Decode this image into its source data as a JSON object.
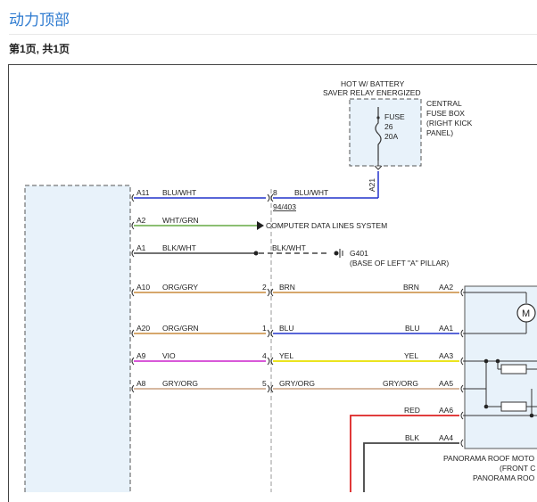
{
  "header": {
    "title": "动力顶部",
    "page_info": "第1页, 共1页"
  },
  "diagram": {
    "hot_label_1": "HOT W/ BATTERY",
    "hot_label_2": "SAVER RELAY ENERGIZED",
    "fuse_box_1": "CENTRAL",
    "fuse_box_2": "FUSE BOX",
    "fuse_box_3": "(RIGHT KICK",
    "fuse_box_4": "PANEL)",
    "fuse_1": "FUSE",
    "fuse_2": "26",
    "fuse_3": "20A",
    "fuse_pin": "A21",
    "wires": {
      "a11_pin": "A11",
      "a11_color": "BLU/WHT",
      "c8_pin": "8",
      "c8_color": "BLU/WHT",
      "c8_ref": "94/403",
      "a2_pin": "A2",
      "a2_color": "WHT/GRN",
      "a2_dest": "COMPUTER DATA LINES SYSTEM",
      "a1_pin": "A1",
      "a1_color": "BLK/WHT",
      "a1_color2": "BLK/WHT",
      "ground": "G401",
      "ground_loc": "(BASE OF LEFT \"A\" PILLAR)",
      "a10_pin": "A10",
      "a10_color": "ORG/GRY",
      "a10_mid_pin": "2",
      "a10_mid_color": "BRN",
      "a10_end_color": "BRN",
      "a10_end_pin": "AA2",
      "a20_pin": "A20",
      "a20_color": "ORG/GRN",
      "a20_mid_pin": "1",
      "a20_mid_color": "BLU",
      "a20_end_color": "BLU",
      "a20_end_pin": "AA1",
      "a9_pin": "A9",
      "a9_color": "VIO",
      "a9_mid_pin": "4",
      "a9_mid_color": "YEL",
      "a9_end_color": "YEL",
      "a9_end_pin": "AA3",
      "a8_pin": "A8",
      "a8_color": "GRY/ORG",
      "a8_mid_pin": "5",
      "a8_mid_color": "GRY/ORG",
      "a8_end_color": "GRY/ORG",
      "a8_end_pin": "AA5",
      "red_color": "RED",
      "red_pin": "AA6",
      "blk_color": "BLK",
      "blk_pin": "AA4"
    },
    "motor_label": "M",
    "motor_1": "PANORAMA ROOF MOTO",
    "motor_2": "(FRONT C",
    "motor_3": "PANORAMA ROO",
    "colors": {
      "blue": "#2233cc",
      "green": "#66aa44",
      "orange": "#c98a3c",
      "violet": "#cc22cc",
      "yellow": "#e8e000",
      "gray_orange": "#c9a080",
      "red": "#dd2222",
      "black": "#444444",
      "box_fill": "#e8f2fa"
    }
  }
}
